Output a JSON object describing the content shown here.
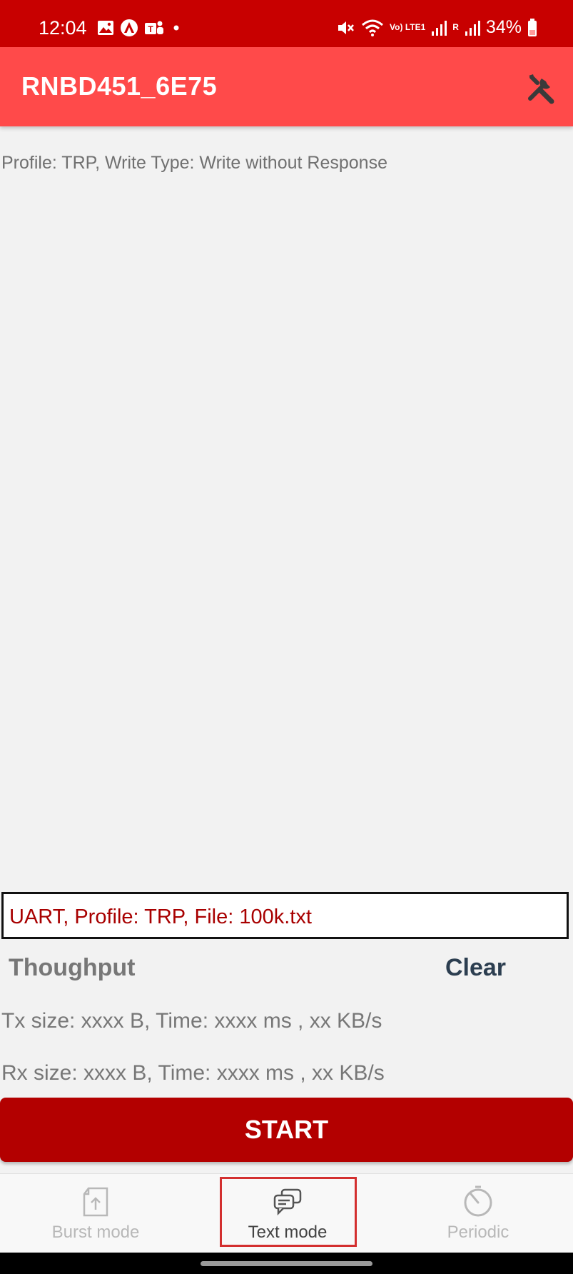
{
  "status_bar": {
    "time": "12:04",
    "battery": "34%",
    "volte_label": "Vo) LTE1",
    "sim2_label": "R",
    "icons": [
      "gallery-icon",
      "app-icon",
      "teams-icon",
      "dot-icon",
      "mute-icon",
      "wifi-icon",
      "signal-icon",
      "battery-icon"
    ],
    "background_color": "#c80000"
  },
  "app_bar": {
    "title": "RNBD451_6E75",
    "action_icon": "tools-icon",
    "background_color": "#ff4a4a"
  },
  "main": {
    "profile_line": "Profile: TRP, Write Type: Write without Response",
    "uart_line": "UART, Profile: TRP, File: 100k.txt",
    "throughput_title": "Thoughput",
    "clear_label": "Clear",
    "tx_line": "Tx size: xxxx B, Time: xxxx ms , xx KB/s",
    "rx_line": "Rx size: xxxx B, Time: xxxx ms , xx KB/s",
    "start_label": "START",
    "start_color": "#b30000"
  },
  "bottom_nav": {
    "items": [
      {
        "label": "Burst mode",
        "icon": "file-upload-icon",
        "active": false
      },
      {
        "label": "Text mode",
        "icon": "chat-icon",
        "active": true
      },
      {
        "label": "Periodic",
        "icon": "timer-icon",
        "active": false
      }
    ]
  }
}
